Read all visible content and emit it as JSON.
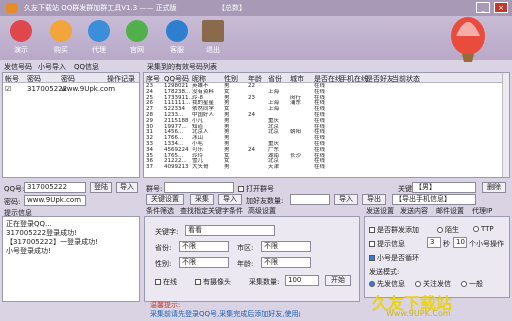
{
  "window": {
    "title": "久友下载站 QQ群发群加群工具V1.3 —— 正式版",
    "caption": "【总数】",
    "min": "_",
    "close": "×"
  },
  "toolbar": [
    {
      "label": "演示",
      "icon": "play-icon",
      "color": "#e0474c"
    },
    {
      "label": "购买",
      "icon": "cart-icon",
      "color": "#f1a53a"
    },
    {
      "label": "代理",
      "icon": "agent-icon",
      "color": "#3b8ed8"
    },
    {
      "label": "官网",
      "icon": "globe-icon",
      "color": "#52b04a"
    },
    {
      "label": "客服",
      "icon": "support-icon",
      "color": "#2f7fd0"
    },
    {
      "label": "退出",
      "icon": "exit-icon",
      "color": "#8a6a4a"
    }
  ],
  "account_tabs": [
    "发信号码",
    "小号导入",
    "QQ信息"
  ],
  "account_table": {
    "headers": [
      "帐号",
      "密码",
      "密码",
      "操作记录"
    ],
    "rows": [
      [
        "☑",
        "317005222",
        "www.9Upk.com",
        ""
      ]
    ]
  },
  "collect_table": {
    "title": "采集到的有效号码列表",
    "headers": [
      "序号",
      "QQ号码",
      "昵称",
      "性别",
      "年龄",
      "省份",
      "城市",
      "是否在线",
      "手机在线",
      "是否好友",
      "当前状态"
    ],
    "rows": [
      [
        "23",
        "1298021",
        "英雄不",
        "男",
        "22",
        "",
        "",
        "在线",
        "",
        "",
        ""
      ],
      [
        "24",
        "178238...",
        "没有资料",
        "女",
        "",
        "上海",
        "",
        "在线",
        "",
        "",
        ""
      ],
      [
        "25",
        "1733911...",
        "玲-8",
        "男",
        "23",
        "",
        "闵行",
        "在线",
        "",
        "",
        ""
      ],
      [
        "26",
        "111111...",
        "我的星星",
        "男",
        "",
        "上海",
        "浦东",
        "在线",
        "",
        "",
        ""
      ],
      [
        "27",
        "522334",
        "依然同学",
        "女",
        "",
        "上海",
        "",
        "在线",
        "",
        "",
        ""
      ],
      [
        "28",
        "1233...",
        "中国好人",
        "男",
        "24",
        "",
        "",
        "在线",
        "",
        "",
        ""
      ],
      [
        "29",
        "2115188",
        "小凡",
        "男",
        "",
        "重庆",
        "",
        "在线",
        "",
        "",
        ""
      ],
      [
        "30",
        "19977...",
        "知道",
        "男",
        "",
        "北京",
        "",
        "在线",
        "",
        "",
        ""
      ],
      [
        "31",
        "1456...",
        "北京人",
        "男",
        "",
        "北京",
        "朝阳",
        "在线",
        "",
        "",
        ""
      ],
      [
        "32",
        "1766...",
        "冰山",
        "男",
        "",
        "",
        "",
        "在线",
        "",
        "",
        ""
      ],
      [
        "33",
        "1334...",
        "小毛",
        "男",
        "",
        "重庆",
        "",
        "在线",
        "",
        "",
        ""
      ],
      [
        "34",
        "4569224",
        "可乐",
        "男",
        "24",
        "广东",
        "",
        "在线",
        "",
        "",
        ""
      ],
      [
        "35",
        "1765...",
        "玲玲",
        "女",
        "",
        "湖南",
        "长沙",
        "在线",
        "",
        "",
        ""
      ],
      [
        "36",
        "21222...",
        "雪儿",
        "女",
        "",
        "北京",
        "",
        "在线",
        "",
        "",
        ""
      ],
      [
        "37",
        "4099213",
        "大头哥",
        "男",
        "",
        "天津",
        "",
        "在线",
        "",
        "",
        ""
      ],
      [
        "38",
        "1882...",
        "黄月",
        "女",
        "",
        "云南",
        "昆明",
        "在线",
        "",
        "",
        ""
      ]
    ]
  },
  "login": {
    "qq_label": "QQ号:",
    "qq_value": "317005222",
    "pwd_label": "密码:",
    "pwd_value": "www.9Upk.com",
    "login_btn": "登陆",
    "import_btn": "导入"
  },
  "log": {
    "title": "提示信息",
    "lines": [
      "正在登录QQ...",
      "317005222登录成功!",
      "【317005222】一登录成功!",
      "小号登录成功!"
    ]
  },
  "group_row": {
    "label": "群号:",
    "value": "",
    "chk": "打开群号",
    "kw_label": "关键:",
    "kw_value": "【男】",
    "btn": "删除"
  },
  "action_row": {
    "b1": "关键设置",
    "b2": "采集",
    "b3": "导入",
    "add_label": "加好友数量:",
    "add_value": "",
    "save_btn": "导入",
    "export_btn": "导出",
    "target": "【导出手机信息】"
  },
  "filter_tabs": [
    "条件筛选",
    "查找指定关键字条件",
    "高级设置"
  ],
  "filter": {
    "kw_label": "关键字:",
    "kw_value": "看看",
    "prov_label": "省份:",
    "prov_value": "不限",
    "city_label": "市区:",
    "city_value": "不限",
    "sex_label": "性别:",
    "sex_value": "不限",
    "age_label": "年龄:",
    "age_value": "不限",
    "online": "在线",
    "cam": "有摄像头",
    "count_label": "采集数量:",
    "count_value": "100",
    "start": "开始"
  },
  "send_tabs": [
    "发送设置",
    "发送内容",
    "邮件设置",
    "代理IP"
  ],
  "send": {
    "opt1": "是否群发添加",
    "opt2": "陌生",
    "opt3": "TTP",
    "opt4": "提示信息",
    "delay_label": "秒",
    "delay_value": "3",
    "per_label": "个小号操作",
    "per_value": "10",
    "opt5": "小号是否循环",
    "mode_label": "发送模式:",
    "m1": "先发信息",
    "m2": "关注发信",
    "m3": "一般",
    "btn": "启动"
  },
  "footer": {
    "tip": "温馨提示:",
    "tip_text": "采集前请先登录QQ号,采集完成后添加好友,使用此软件请遵守相关法律法规。"
  },
  "watermark": {
    "text": "久友下载站",
    "url": "Www.9UPK.Com",
    "color": "#e8d21a"
  }
}
